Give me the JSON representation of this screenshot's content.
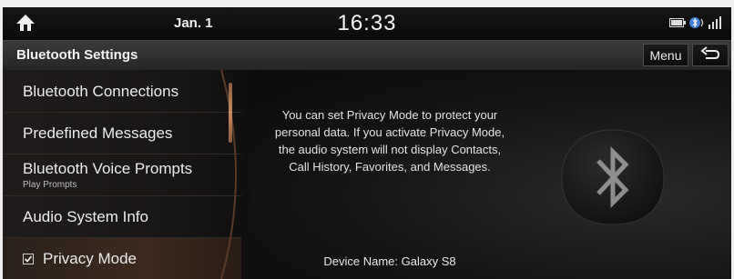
{
  "status_bar": {
    "date": "Jan. 1",
    "time": "16:33",
    "icons": [
      "home-icon",
      "battery-icon",
      "bluetooth-audio-icon",
      "signal-icon"
    ]
  },
  "title_bar": {
    "title": "Bluetooth Settings",
    "menu_label": "Menu",
    "back_icon": "back-arrow-icon"
  },
  "menu": {
    "items": [
      {
        "label": "Bluetooth Connections"
      },
      {
        "label": "Predefined Messages"
      },
      {
        "label": "Bluetooth Voice Prompts",
        "sublabel": "Play Prompts"
      },
      {
        "label": "Audio System Info"
      },
      {
        "label": "Privacy Mode",
        "checked": true,
        "selected": true
      }
    ]
  },
  "content": {
    "description": "You can set Privacy Mode to protect your personal data. If you activate Privacy Mode, the audio system will not display Contacts, Call History, Favorites, and Messages.",
    "device_name": "Device Name: Galaxy S8",
    "illustration_icon": "bluetooth-icon"
  },
  "colors": {
    "accent": "#c58a5a",
    "selected_row": "#3e2a1e",
    "background": "#0d0d0d"
  }
}
